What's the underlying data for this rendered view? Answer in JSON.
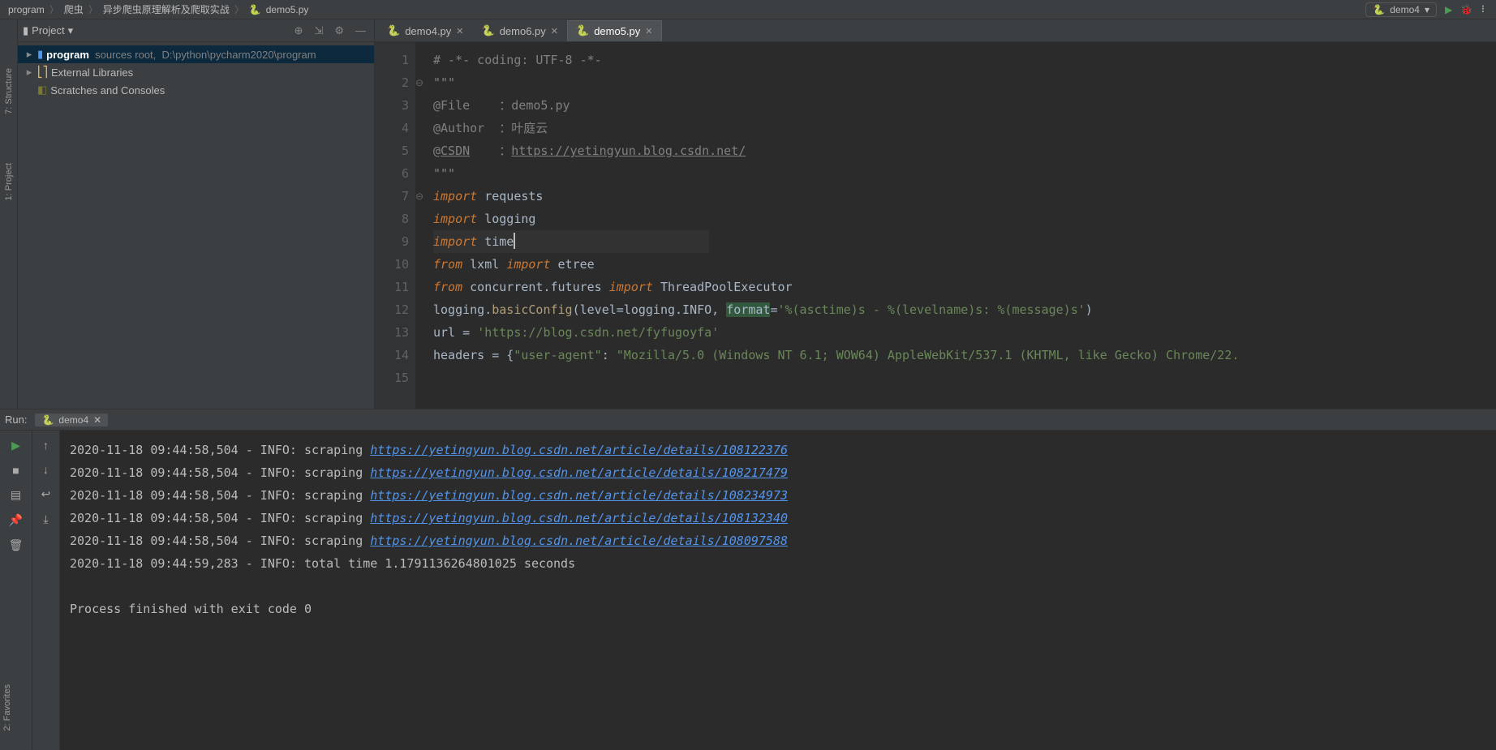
{
  "topbar": {
    "breadcrumbs": [
      "program",
      "爬虫",
      "异步爬虫原理解析及爬取实战",
      "demo5.py"
    ],
    "run_config": "demo4"
  },
  "left_tabs": {
    "structure": "7: Structure",
    "project": "1: Project",
    "favorites": "2: Favorites"
  },
  "project": {
    "title": "Project",
    "root": {
      "name": "program",
      "note": "sources root,",
      "path": "D:\\python\\pycharm2020\\program"
    },
    "external_libraries": "External Libraries",
    "scratches": "Scratches and Consoles"
  },
  "tabs": [
    {
      "label": "demo4.py",
      "active": false
    },
    {
      "label": "demo6.py",
      "active": false
    },
    {
      "label": "demo5.py",
      "active": true
    }
  ],
  "code": {
    "lines": [
      {
        "n": 1,
        "tokens": [
          {
            "t": "# -*- coding: UTF-8 -*-",
            "cls": "c-comment"
          }
        ]
      },
      {
        "n": 2,
        "tokens": [
          {
            "t": "\"\"\"",
            "cls": "c-comment"
          }
        ]
      },
      {
        "n": 3,
        "tokens": [
          {
            "t": "@File    ：demo5.py",
            "cls": "c-comment"
          }
        ]
      },
      {
        "n": 4,
        "tokens": [
          {
            "t": "@Author  ：叶庭云",
            "cls": "c-comment"
          }
        ]
      },
      {
        "n": 5,
        "tokens": [
          {
            "t": "@",
            "cls": "c-comment"
          },
          {
            "t": "CSDN",
            "cls": "c-commentlink"
          },
          {
            "t": "    ：",
            "cls": "c-comment"
          },
          {
            "t": "https://yetingyun.blog.csdn.net/",
            "cls": "c-commentlink"
          }
        ]
      },
      {
        "n": 6,
        "tokens": [
          {
            "t": "\"\"\"",
            "cls": "c-comment"
          }
        ]
      },
      {
        "n": 7,
        "tokens": [
          {
            "t": "import",
            "cls": "c-kw"
          },
          {
            "t": " requests",
            "cls": "c-id"
          }
        ]
      },
      {
        "n": 8,
        "tokens": [
          {
            "t": "import",
            "cls": "c-kw"
          },
          {
            "t": " logging",
            "cls": "c-id"
          }
        ]
      },
      {
        "n": 9,
        "hl": true,
        "tokens": [
          {
            "t": "import",
            "cls": "c-kw"
          },
          {
            "t": " time",
            "cls": "c-id"
          }
        ],
        "caret": true
      },
      {
        "n": 10,
        "tokens": [
          {
            "t": "from",
            "cls": "c-kw"
          },
          {
            "t": " lxml ",
            "cls": "c-id"
          },
          {
            "t": "import",
            "cls": "c-kw"
          },
          {
            "t": " etree",
            "cls": "c-id"
          }
        ]
      },
      {
        "n": 11,
        "tokens": [
          {
            "t": "from",
            "cls": "c-kw"
          },
          {
            "t": " concurrent.futures ",
            "cls": "c-id"
          },
          {
            "t": "import",
            "cls": "c-kw"
          },
          {
            "t": " ThreadPoolExecutor",
            "cls": "c-id"
          }
        ]
      },
      {
        "n": 12,
        "tokens": [
          {
            "t": "",
            "cls": "c-id"
          }
        ]
      },
      {
        "n": 13,
        "tokens": [
          {
            "t": "logging.",
            "cls": "c-id"
          },
          {
            "t": "basicConfig",
            "cls": "c-fn"
          },
          {
            "t": "(",
            "cls": "c-id"
          },
          {
            "t": "level",
            "cls": "c-param"
          },
          {
            "t": "=logging.INFO, ",
            "cls": "c-id"
          },
          {
            "t": "format",
            "cls": "c-hl"
          },
          {
            "t": "=",
            "cls": "c-id"
          },
          {
            "t": "'%(asctime)s - %(levelname)s: %(message)s'",
            "cls": "c-str"
          },
          {
            "t": ")",
            "cls": "c-id"
          }
        ]
      },
      {
        "n": 14,
        "tokens": [
          {
            "t": "url = ",
            "cls": "c-id"
          },
          {
            "t": "'https://blog.csdn.net/fyfugoyfa'",
            "cls": "c-str"
          }
        ]
      },
      {
        "n": 15,
        "tokens": [
          {
            "t": "headers = {",
            "cls": "c-id"
          },
          {
            "t": "\"user-agent\"",
            "cls": "c-str"
          },
          {
            "t": ": ",
            "cls": "c-id"
          },
          {
            "t": "\"Mozilla/5.0 (Windows NT 6.1; WOW64) AppleWebKit/537.1 (KHTML, like Gecko) Chrome/22.",
            "cls": "c-str"
          }
        ]
      }
    ]
  },
  "run": {
    "title": "Run:",
    "tab": "demo4",
    "lines": [
      {
        "ts": "2020-11-18 09:44:58,504 - INFO: scraping ",
        "url": "https://yetingyun.blog.csdn.net/article/details/108122376"
      },
      {
        "ts": "2020-11-18 09:44:58,504 - INFO: scraping ",
        "url": "https://yetingyun.blog.csdn.net/article/details/108217479"
      },
      {
        "ts": "2020-11-18 09:44:58,504 - INFO: scraping ",
        "url": "https://yetingyun.blog.csdn.net/article/details/108234973"
      },
      {
        "ts": "2020-11-18 09:44:58,504 - INFO: scraping ",
        "url": "https://yetingyun.blog.csdn.net/article/details/108132340"
      },
      {
        "ts": "2020-11-18 09:44:58,504 - INFO: scraping ",
        "url": "https://yetingyun.blog.csdn.net/article/details/108097588"
      },
      {
        "ts": "2020-11-18 09:44:59,283 - INFO: total time 1.1791136264801025 seconds"
      }
    ],
    "exit": "Process finished with exit code 0"
  }
}
